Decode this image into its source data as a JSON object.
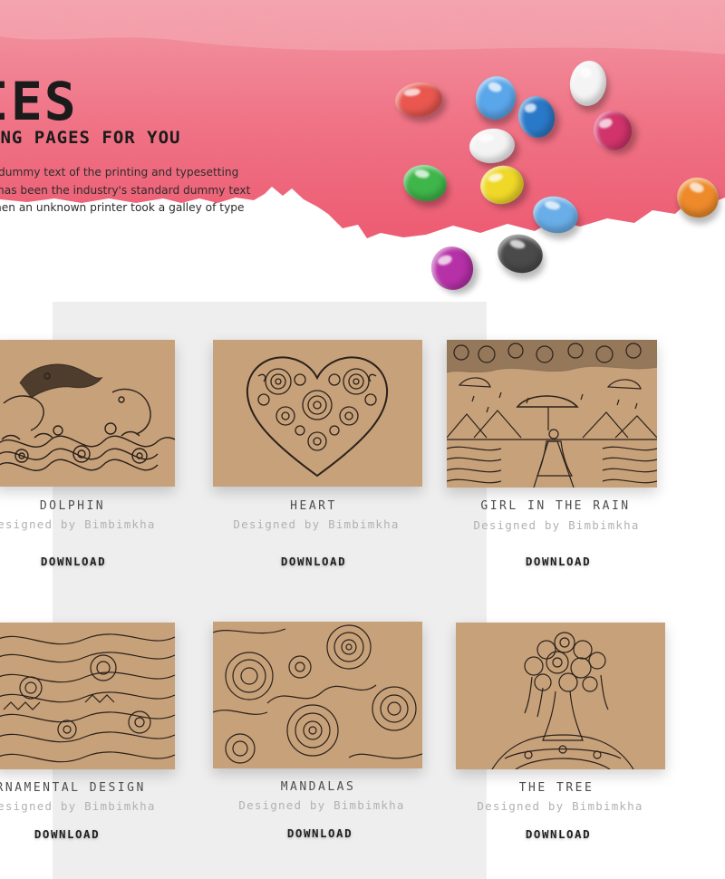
{
  "hero": {
    "title": "DIES",
    "subtitle": "ING PAGES FOR YOU",
    "text_lines": [
      "dummy text of the printing and typesetting",
      "has been the industry's standard dummy text",
      "hen an unknown printer took a galley of type"
    ],
    "paint_color": "#f26b80",
    "candies": [
      {
        "color": "#e9574f"
      },
      {
        "color": "#5aa6ea"
      },
      {
        "color": "#2a79c8"
      },
      {
        "color": "#f4f4f4"
      },
      {
        "color": "#d1336b"
      },
      {
        "color": "#f3f3f3"
      },
      {
        "color": "#3fb64a"
      },
      {
        "color": "#efd828"
      },
      {
        "color": "#69aee8"
      },
      {
        "color": "#ee8a2a"
      },
      {
        "color": "#b630a8"
      },
      {
        "color": "#4a4a4a"
      }
    ]
  },
  "gallery": {
    "items": [
      {
        "title": "DOLPHIN",
        "author": "Designed by Bimbimkha",
        "download": "DOWNLOAD",
        "art": "dolphin-art"
      },
      {
        "title": "HEART",
        "author": "Designed by Bimbimkha",
        "download": "DOWNLOAD",
        "art": "heart-art"
      },
      {
        "title": "GIRL IN THE RAIN",
        "author": "Designed by Bimbimkha",
        "download": "DOWNLOAD",
        "art": "girl-in-rain-art"
      },
      {
        "title": "ORNAMENTAL DESIGN",
        "author": "Designed by Bimbimkha",
        "download": "DOWNLOAD",
        "art": "ornamental-art"
      },
      {
        "title": "MANDALAS",
        "author": "Designed by Bimbimkha",
        "download": "DOWNLOAD",
        "art": "mandalas-art"
      },
      {
        "title": "THE TREE",
        "author": "Designed by Bimbimkha",
        "download": "DOWNLOAD",
        "art": "tree-art"
      }
    ],
    "kraft_color": "#c7a17a",
    "ink_color": "#2a211a",
    "band_color": "#eeeeee"
  }
}
